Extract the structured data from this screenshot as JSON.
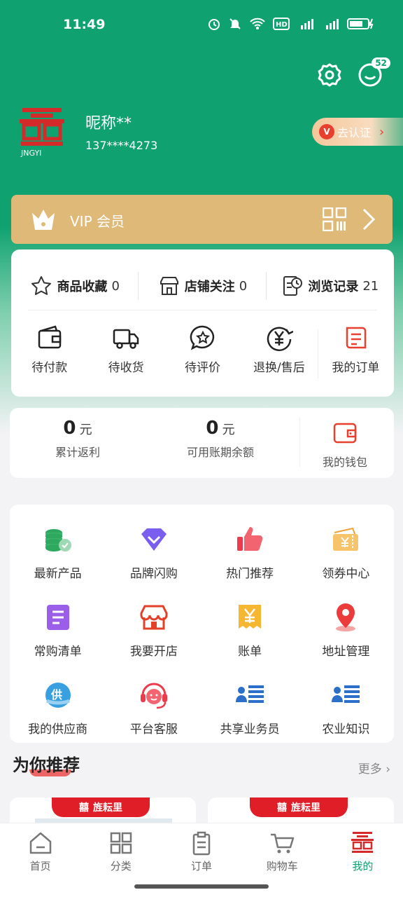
{
  "status": {
    "time": "11:49",
    "notif_count": "52"
  },
  "profile": {
    "nickname": "昵称**",
    "phone": "137****4273",
    "verify_label": "去认证",
    "logo_caption": "JNGYI"
  },
  "vip": {
    "label": "VIP 会员"
  },
  "stats": [
    {
      "label": "商品收藏",
      "count": "0",
      "icon": "star-icon"
    },
    {
      "label": "店铺关注",
      "count": "0",
      "icon": "store-icon"
    },
    {
      "label": "浏览记录",
      "count": "21",
      "icon": "history-icon"
    }
  ],
  "orders": [
    {
      "label": "待付款",
      "icon": "wallet-icon"
    },
    {
      "label": "待收货",
      "icon": "truck-icon"
    },
    {
      "label": "待评价",
      "icon": "review-icon"
    },
    {
      "label": "退换/售后",
      "icon": "refund-icon"
    },
    {
      "label": "我的订单",
      "icon": "order-list-icon"
    }
  ],
  "wallet": {
    "rebate": {
      "value": "0",
      "unit": "元",
      "label": "累计返利"
    },
    "credit": {
      "value": "0",
      "unit": "元",
      "label": "可用账期余额"
    },
    "my_wallet": "我的钱包"
  },
  "tools": [
    {
      "label": "最新产品",
      "icon": "coins-icon",
      "color": "#2fa85f"
    },
    {
      "label": "品牌闪购",
      "icon": "diamond-icon",
      "color": "#7a5ef0"
    },
    {
      "label": "热门推荐",
      "icon": "thumbs-up-icon",
      "color": "#ec3b4d"
    },
    {
      "label": "领券中心",
      "icon": "coupon-icon",
      "color": "#f0a23a"
    },
    {
      "label": "常购清单",
      "icon": "list-icon",
      "color": "#9b5ee8"
    },
    {
      "label": "我要开店",
      "icon": "shop-icon",
      "color": "#e3402a"
    },
    {
      "label": "账单",
      "icon": "bill-icon",
      "color": "#f5b731"
    },
    {
      "label": "地址管理",
      "icon": "location-icon",
      "color": "#ec3b3b"
    },
    {
      "label": "我的供应商",
      "icon": "supplier-icon",
      "color": "#38a0e0"
    },
    {
      "label": "平台客服",
      "icon": "service-icon",
      "color": "#ec3b4d"
    },
    {
      "label": "共享业务员",
      "icon": "staff-icon",
      "color": "#2b6fc8"
    },
    {
      "label": "农业知识",
      "icon": "knowledge-icon",
      "color": "#2b6fc8"
    }
  ],
  "recommend": {
    "title": "为你推荐",
    "more": "更多",
    "brand": "旌耘里"
  },
  "tabs": [
    {
      "label": "首页",
      "icon": "home-icon"
    },
    {
      "label": "分类",
      "icon": "category-icon"
    },
    {
      "label": "订单",
      "icon": "order-icon"
    },
    {
      "label": "购物车",
      "icon": "cart-icon"
    },
    {
      "label": "我的",
      "icon": "profile-logo-icon"
    }
  ],
  "colors": {
    "primary": "#0fa270",
    "vip": "#dfb978",
    "accent": "#e01e28"
  }
}
